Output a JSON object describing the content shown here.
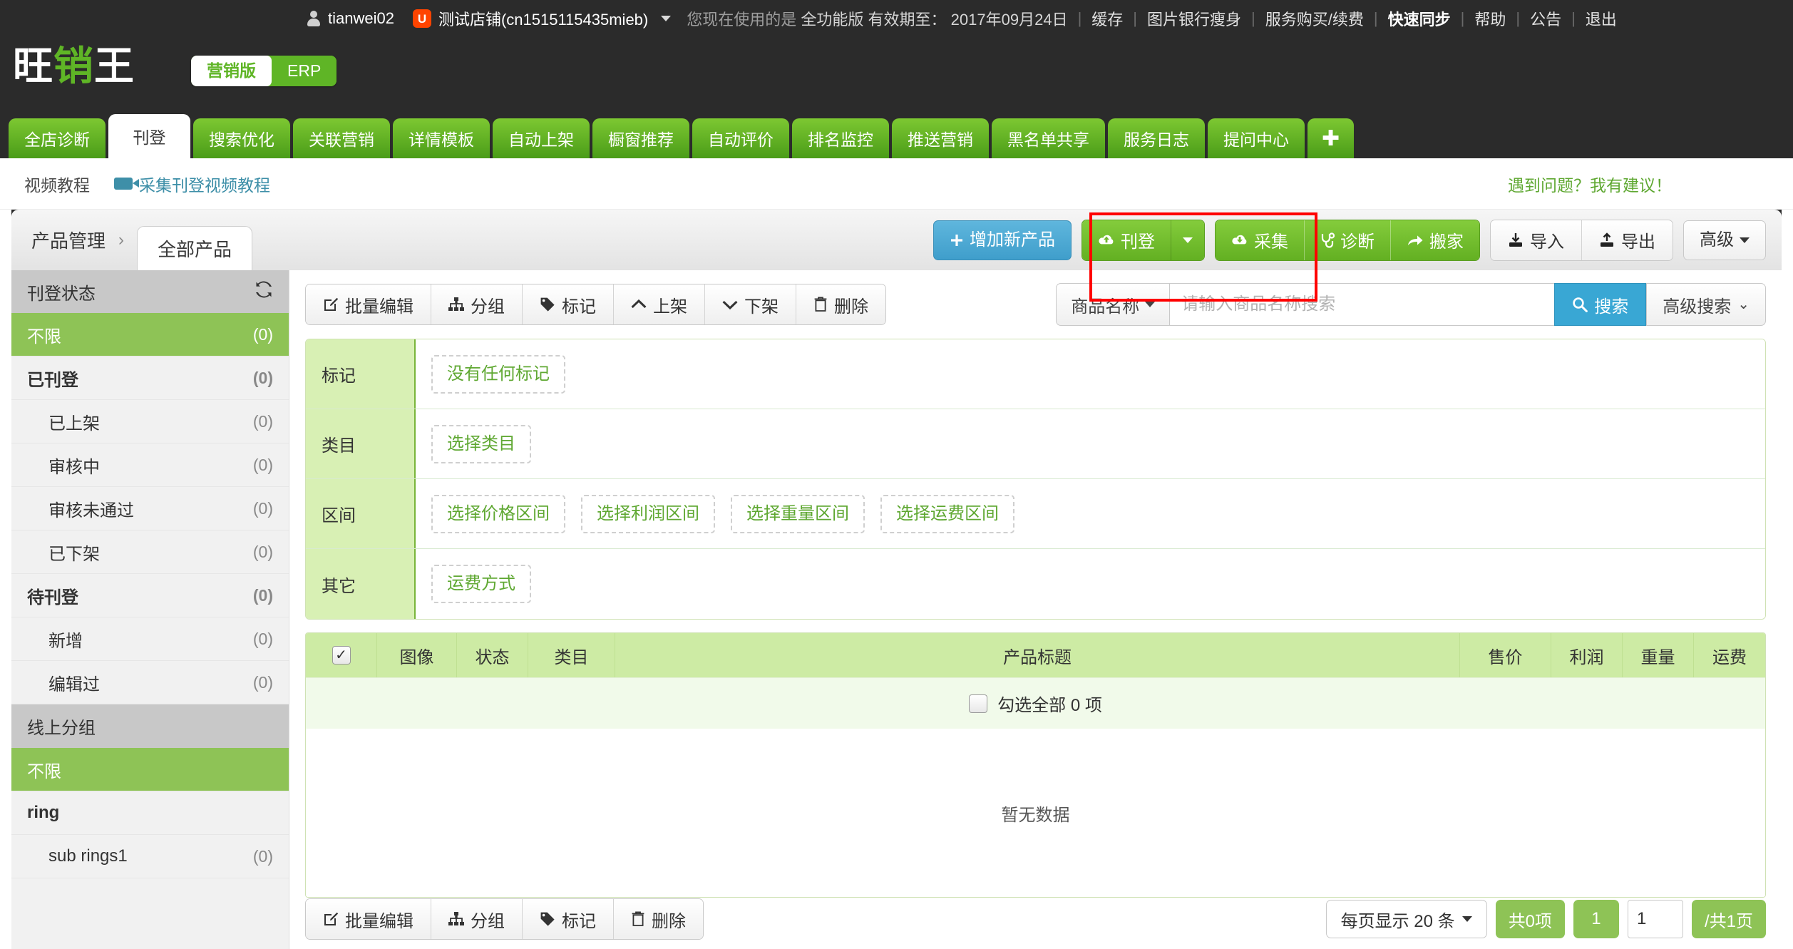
{
  "topbar": {
    "username": "tianwei02",
    "shop_name": "测试店铺(cn1515115435mieb)",
    "shop_icon": "aliexpress-icon",
    "notice_prefix": "您现在使用的是",
    "notice_edition": "全功能版",
    "notice_expiry_label": "有效期至：",
    "notice_expiry_date": "2017年09月24日",
    "links": [
      {
        "label": "缓存",
        "bold": false
      },
      {
        "label": "图片银行瘦身",
        "bold": false
      },
      {
        "label": "服务购买/续费",
        "bold": false
      },
      {
        "label": "快速同步",
        "bold": true
      },
      {
        "label": "帮助",
        "bold": false
      },
      {
        "label": "公告",
        "bold": false
      },
      {
        "label": "退出",
        "bold": false
      }
    ]
  },
  "brand": {
    "logo_part1": "旺",
    "logo_part2": "销",
    "logo_part3": "王",
    "version_active": "营销版",
    "version_inactive": "ERP"
  },
  "nav": {
    "tabs": [
      {
        "label": "全店诊断",
        "active": false
      },
      {
        "label": "刊登",
        "active": true
      },
      {
        "label": "搜索优化",
        "active": false
      },
      {
        "label": "关联营销",
        "active": false
      },
      {
        "label": "详情模板",
        "active": false
      },
      {
        "label": "自动上架",
        "active": false
      },
      {
        "label": "橱窗推荐",
        "active": false
      },
      {
        "label": "自动评价",
        "active": false
      },
      {
        "label": "排名监控",
        "active": false
      },
      {
        "label": "推送营销",
        "active": false
      },
      {
        "label": "黑名单共享",
        "active": false
      },
      {
        "label": "服务日志",
        "active": false
      },
      {
        "label": "提问中心",
        "active": false
      }
    ],
    "add_tab_label": "✚"
  },
  "tutorial": {
    "label": "视频教程",
    "link_label": "采集刊登视频教程",
    "video_icon": "video-camera-icon",
    "feedback": "遇到问题？我有建议！"
  },
  "breadcrumb": {
    "root": "产品管理",
    "separator": "›",
    "current_tab": "全部产品"
  },
  "header_actions": {
    "add_product": {
      "label": "增加新产品",
      "icon": "plus-icon"
    },
    "publish": {
      "label": "刊登",
      "icon": "cloud-upload-icon",
      "dropdown_icon": "caret-down-icon"
    },
    "collect": {
      "label": "采集",
      "icon": "cloud-download-icon"
    },
    "diagnose": {
      "label": "诊断",
      "icon": "stethoscope-icon"
    },
    "migrate": {
      "label": "搬家",
      "icon": "arrow-forward-icon"
    },
    "import": {
      "label": "导入",
      "icon": "download-tray-icon"
    },
    "export": {
      "label": "导出",
      "icon": "upload-tray-icon"
    },
    "advanced": {
      "label": "高级",
      "icon": "caret-down-icon"
    }
  },
  "sidebar": {
    "status_group": {
      "title": "刊登状态",
      "refresh_icon": "refresh-icon",
      "items": [
        {
          "label": "不限",
          "count": "(0)",
          "selected": true,
          "bold": false,
          "indent": false
        },
        {
          "label": "已刊登",
          "count": "(0)",
          "selected": false,
          "bold": true,
          "indent": false
        },
        {
          "label": "已上架",
          "count": "(0)",
          "selected": false,
          "bold": false,
          "indent": true
        },
        {
          "label": "审核中",
          "count": "(0)",
          "selected": false,
          "bold": false,
          "indent": true
        },
        {
          "label": "审核未通过",
          "count": "(0)",
          "selected": false,
          "bold": false,
          "indent": true
        },
        {
          "label": "已下架",
          "count": "(0)",
          "selected": false,
          "bold": false,
          "indent": true
        },
        {
          "label": "待刊登",
          "count": "(0)",
          "selected": false,
          "bold": true,
          "indent": false
        },
        {
          "label": "新增",
          "count": "(0)",
          "selected": false,
          "bold": false,
          "indent": true
        },
        {
          "label": "编辑过",
          "count": "(0)",
          "selected": false,
          "bold": false,
          "indent": true
        }
      ]
    },
    "online_group": {
      "title": "线上分组",
      "items": [
        {
          "label": "不限",
          "count": "",
          "selected": true,
          "bold": false,
          "indent": false
        },
        {
          "label": "ring",
          "count": "",
          "selected": false,
          "bold": true,
          "indent": false
        },
        {
          "label": "sub rings1",
          "count": "(0)",
          "selected": false,
          "bold": false,
          "indent": true
        }
      ]
    }
  },
  "op_toolbar": {
    "buttons": [
      {
        "label": "批量编辑",
        "icon": "edit-square-icon"
      },
      {
        "label": "分组",
        "icon": "sitemap-icon"
      },
      {
        "label": "标记",
        "icon": "tag-icon"
      },
      {
        "label": "上架",
        "icon": "chevron-up-icon"
      },
      {
        "label": "下架",
        "icon": "chevron-down-icon"
      },
      {
        "label": "删除",
        "icon": "trash-icon"
      }
    ]
  },
  "search": {
    "field_label": "商品名称",
    "field_caret_icon": "caret-down-icon",
    "placeholder": "请输入商品名称搜索",
    "value": "",
    "search_label": "搜索",
    "search_icon": "search-icon",
    "advanced_label": "高级搜索",
    "advanced_icon": "chevron-double-down-icon"
  },
  "filters": [
    {
      "key": "标记",
      "chips": [
        "没有任何标记"
      ]
    },
    {
      "key": "类目",
      "chips": [
        "选择类目"
      ]
    },
    {
      "key": "区间",
      "chips": [
        "选择价格区间",
        "选择利润区间",
        "选择重量区间",
        "选择运费区间"
      ]
    },
    {
      "key": "其它",
      "chips": [
        "运费方式"
      ]
    }
  ],
  "table": {
    "header_checkbox_checked": true,
    "columns": [
      "图像",
      "状态",
      "类目",
      "产品标题",
      "售价",
      "利润",
      "重量",
      "运费"
    ],
    "select_all_label": "勾选全部 0 项",
    "select_all_checked": false,
    "empty_text": "暂无数据",
    "rows": []
  },
  "bottom_toolbar": {
    "buttons": [
      {
        "label": "批量编辑",
        "icon": "edit-square-icon"
      },
      {
        "label": "分组",
        "icon": "sitemap-icon"
      },
      {
        "label": "标记",
        "icon": "tag-icon"
      },
      {
        "label": "删除",
        "icon": "trash-icon"
      }
    ]
  },
  "pagination": {
    "page_size_label": "每页显示 20 条",
    "total_items_label": "共0项",
    "current_page_chip": "1",
    "page_input_value": "1",
    "total_pages_label": "/共1页"
  },
  "colors": {
    "brand_green": "#5fb526",
    "accent_blue": "#39a7d4",
    "dark_chrome": "#2b2b2b",
    "annotation_red": "#ff0000",
    "selected_green": "#8ec356",
    "filter_key_green": "#d8f0b4",
    "table_header_green": "#cdeba4"
  }
}
